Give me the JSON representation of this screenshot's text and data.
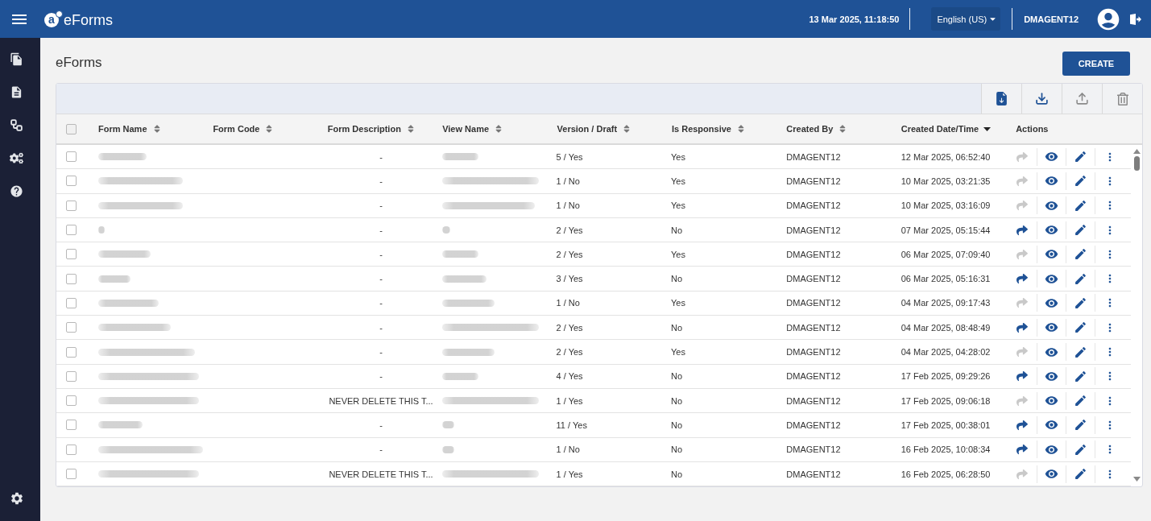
{
  "header": {
    "logo": {
      "mark": "a",
      "title": "eForms"
    },
    "datetime": "13 Mar 2025, 11:18:50",
    "language": "English (US)",
    "user": "DMAGENT12"
  },
  "page": {
    "title": "eForms",
    "create_button": "CREATE"
  },
  "toolbar": {
    "buttons": [
      {
        "kind": "import",
        "disabled": false
      },
      {
        "kind": "download",
        "disabled": false
      },
      {
        "kind": "upload",
        "disabled": true
      },
      {
        "kind": "delete",
        "disabled": true
      }
    ]
  },
  "table": {
    "select_all": {
      "checked": false
    },
    "columns": [
      {
        "label": "Form Name",
        "sortable": true,
        "sorted": false
      },
      {
        "label": "Form Code",
        "sortable": true,
        "sorted": false
      },
      {
        "label": "Form Description",
        "sortable": true,
        "sorted": false
      },
      {
        "label": "View Name",
        "sortable": true,
        "sorted": false
      },
      {
        "label": "Version / Draft",
        "sortable": true,
        "sorted": false
      },
      {
        "label": "Is Responsive",
        "sortable": true,
        "sorted": false
      },
      {
        "label": "Created By",
        "sortable": true,
        "sorted": false
      },
      {
        "label": "Created Date/Time",
        "sortable": true,
        "sorted": true
      },
      {
        "label": "Actions",
        "sortable": false
      }
    ],
    "rows": [
      {
        "checked": false,
        "form_description": "-",
        "version_draft": "5 / Yes",
        "is_responsive": "Yes",
        "created_by": "DMAGENT12",
        "created_date_time": "12 Mar 2025, 06:52:40",
        "share_disabled": true
      },
      {
        "checked": false,
        "form_description": "-",
        "version_draft": "1 / No",
        "is_responsive": "Yes",
        "created_by": "DMAGENT12",
        "created_date_time": "10 Mar 2025, 03:21:35",
        "share_disabled": true
      },
      {
        "checked": false,
        "form_description": "-",
        "version_draft": "1 / No",
        "is_responsive": "Yes",
        "created_by": "DMAGENT12",
        "created_date_time": "10 Mar 2025, 03:16:09",
        "share_disabled": true
      },
      {
        "checked": false,
        "form_description": "-",
        "version_draft": "2 / Yes",
        "is_responsive": "No",
        "created_by": "DMAGENT12",
        "created_date_time": "07 Mar 2025, 05:15:44",
        "share_disabled": false
      },
      {
        "checked": false,
        "form_description": "-",
        "version_draft": "2 / Yes",
        "is_responsive": "Yes",
        "created_by": "DMAGENT12",
        "created_date_time": "06 Mar 2025, 07:09:40",
        "share_disabled": true
      },
      {
        "checked": false,
        "form_description": "-",
        "version_draft": "3 / Yes",
        "is_responsive": "No",
        "created_by": "DMAGENT12",
        "created_date_time": "06 Mar 2025, 05:16:31",
        "share_disabled": false
      },
      {
        "checked": false,
        "form_description": "-",
        "version_draft": "1 / No",
        "is_responsive": "Yes",
        "created_by": "DMAGENT12",
        "created_date_time": "04 Mar 2025, 09:17:43",
        "share_disabled": true
      },
      {
        "checked": false,
        "form_description": "-",
        "version_draft": "2 / Yes",
        "is_responsive": "No",
        "created_by": "DMAGENT12",
        "created_date_time": "04 Mar 2025, 08:48:49",
        "share_disabled": false
      },
      {
        "checked": false,
        "form_description": "-",
        "version_draft": "2 / Yes",
        "is_responsive": "Yes",
        "created_by": "DMAGENT12",
        "created_date_time": "04 Mar 2025, 04:28:02",
        "share_disabled": true
      },
      {
        "checked": false,
        "form_description": "-",
        "version_draft": "4 / Yes",
        "is_responsive": "No",
        "created_by": "DMAGENT12",
        "created_date_time": "17 Feb 2025, 09:29:26",
        "share_disabled": false
      },
      {
        "checked": false,
        "form_description": "NEVER DELETE THIS T...",
        "version_draft": "1 / Yes",
        "is_responsive": "No",
        "created_by": "DMAGENT12",
        "created_date_time": "17 Feb 2025, 09:06:18",
        "share_disabled": true
      },
      {
        "checked": false,
        "form_description": "-",
        "version_draft": "11 / Yes",
        "is_responsive": "No",
        "created_by": "DMAGENT12",
        "created_date_time": "17 Feb 2025, 00:38:01",
        "share_disabled": false
      },
      {
        "checked": false,
        "form_description": "-",
        "version_draft": "1 / No",
        "is_responsive": "No",
        "created_by": "DMAGENT12",
        "created_date_time": "16 Feb 2025, 10:08:34",
        "share_disabled": false
      },
      {
        "checked": false,
        "form_description": "NEVER DELETE THIS T...",
        "version_draft": "1 / Yes",
        "is_responsive": "No",
        "created_by": "DMAGENT12",
        "created_date_time": "16 Feb 2025, 06:28:50",
        "share_disabled": true
      }
    ]
  }
}
